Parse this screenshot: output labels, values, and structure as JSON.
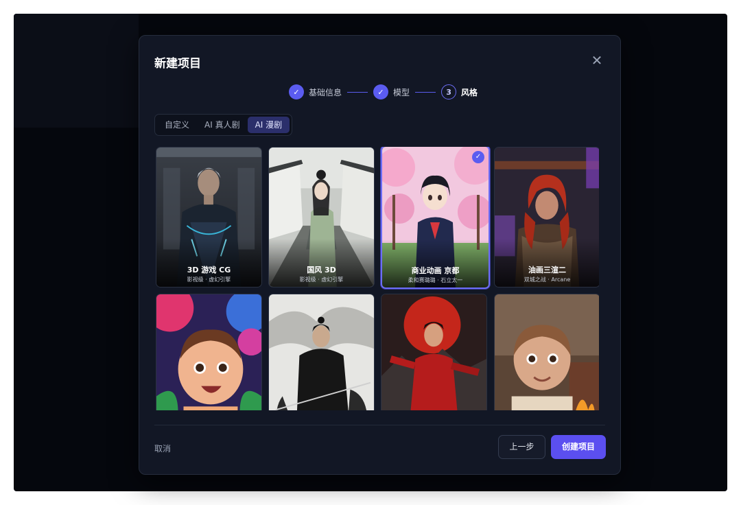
{
  "dialog": {
    "title": "新建项目",
    "close_icon": "close-icon"
  },
  "stepper": {
    "steps": [
      {
        "number": "1",
        "label": "基础信息",
        "state": "done"
      },
      {
        "number": "2",
        "label": "模型",
        "state": "done"
      },
      {
        "number": "3",
        "label": "风格",
        "state": "current"
      }
    ],
    "check_glyph": "✓"
  },
  "tabs": [
    {
      "label": "自定义",
      "active": false
    },
    {
      "label": "AI 真人剧",
      "active": false
    },
    {
      "label": "AI 漫剧",
      "active": true
    }
  ],
  "styles": [
    {
      "title": "3D 游戏 CG",
      "subtitle": "影视级 · 虚幻引擎",
      "selected": false
    },
    {
      "title": "国风 3D",
      "subtitle": "影视级 · 虚幻引擎",
      "selected": false
    },
    {
      "title": "商业动画 京都",
      "subtitle": "柔和赛璐璐 · 石立太一",
      "selected": true
    },
    {
      "title": "油画三渲二",
      "subtitle": "双城之战 · Arcane",
      "selected": false
    },
    {
      "title": "",
      "subtitle": "",
      "selected": false
    },
    {
      "title": "",
      "subtitle": "",
      "selected": false
    },
    {
      "title": "",
      "subtitle": "",
      "selected": false
    },
    {
      "title": "",
      "subtitle": "",
      "selected": false
    }
  ],
  "footer": {
    "cancel_label": "取消",
    "prev_label": "上一步",
    "create_label": "创建项目"
  },
  "colors": {
    "accent": "#5b5cf0",
    "modal_bg": "#121725",
    "backdrop": "#05070d"
  }
}
